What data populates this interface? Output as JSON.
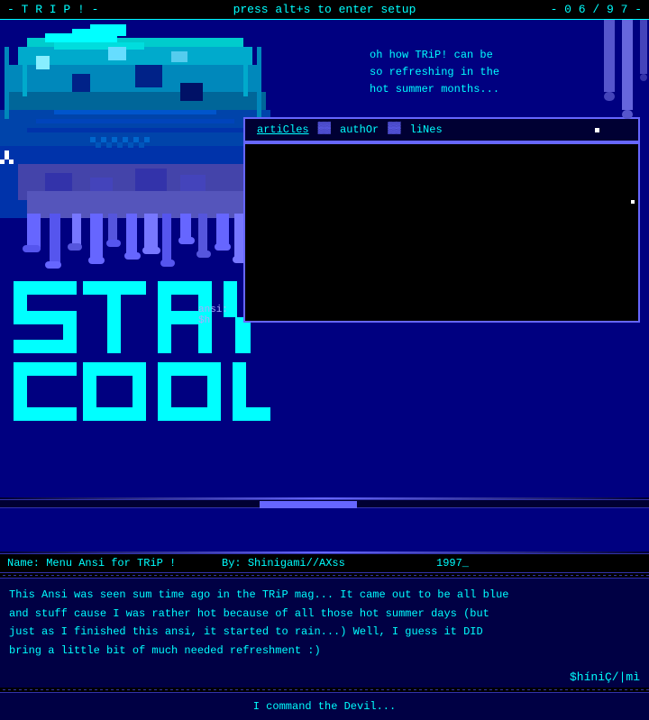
{
  "topbar": {
    "title": "- T R I P ! -",
    "instruction": "press alt+s to enter setup",
    "issue": "- 0 6 / 9 7 -"
  },
  "ansi_art": {
    "label": "ansi:",
    "label2": "$h"
  },
  "stay_cool": {
    "line1": "STaY",
    "line2": "COoL"
  },
  "tagline": "oh how TRiP! can be\nso refreshing in the\nhot summer months...",
  "nav": {
    "tabs": [
      {
        "label": "artiCles",
        "active": true
      },
      {
        "label": "authOr"
      },
      {
        "label": "liNes"
      }
    ]
  },
  "file_info": {
    "name_label": "Name:",
    "name_value": "Menu Ansi for TRiP !",
    "by_label": "By:",
    "by_value": "Shinigami//AXss",
    "year": "1997_"
  },
  "description": "This Ansi was seen sum time ago in the TRiP mag... It came out to be all blue\nand stuff cause I was rather hot because of all those hot summer days (but\njust as I finished this ansi, it started to rain...) Well, I guess it DID\nbring a little bit of much needed refreshment :)",
  "author_sig": "$híniÇ/|mì",
  "bottom_text": "I command the Devil...",
  "scrollbar": {
    "thumb_left": "40%",
    "thumb_width": "15%"
  }
}
